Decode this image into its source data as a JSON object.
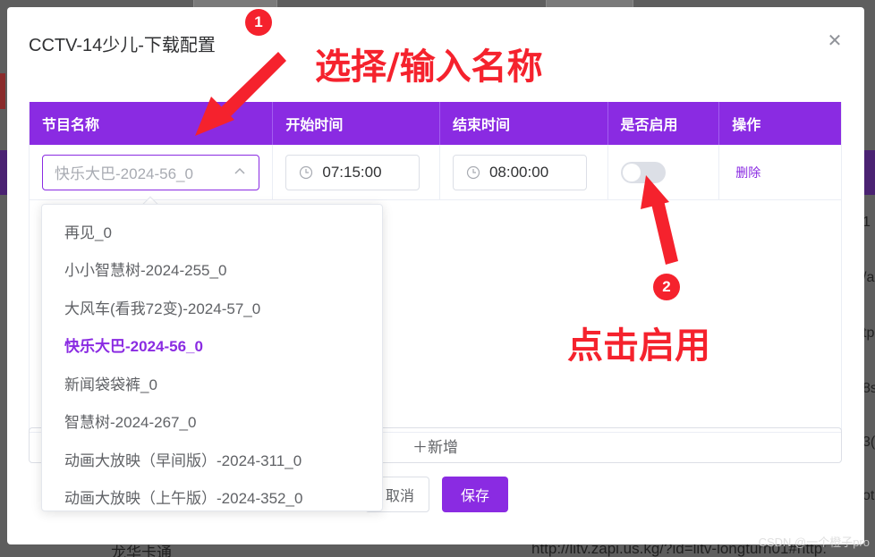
{
  "background": {
    "bottom_left_text": "龙华卡通",
    "bottom_right_text": "http://litv.zapi.us.kg/?id=litv-longturn01#http:",
    "right_col_fragments": [
      "1",
      "/a",
      "tp",
      "8s",
      "3(",
      "ot"
    ],
    "watermark": "CSDN @一个橙子pro"
  },
  "dialog": {
    "title": "CCTV-14少儿-下载配置",
    "close_icon": "close-icon"
  },
  "table": {
    "headers": [
      "节目名称",
      "开始时间",
      "结束时间",
      "是否启用",
      "操作"
    ],
    "row": {
      "program": "快乐大巴-2024-56_0",
      "start": "07:15:00",
      "end": "08:00:00",
      "enabled": false,
      "action": "删除"
    }
  },
  "dropdown": {
    "items": [
      "再见_0",
      "小小智慧树-2024-255_0",
      "大风车(看我72变)-2024-57_0",
      "快乐大巴-2024-56_0",
      "新闻袋袋裤_0",
      "智慧树-2024-267_0",
      "动画大放映（早间版）-2024-311_0",
      "动画大放映（上午版）-2024-352_0"
    ],
    "selected_index": 3
  },
  "add_button": "＋新增",
  "buttons": {
    "cancel": "取消",
    "save": "保存"
  },
  "annotations": {
    "step1_badge": "1",
    "step1_text": "选择/输入名称",
    "step2_badge": "2",
    "step2_text": "点击启用"
  },
  "colors": {
    "accent": "#8a2be2",
    "annotation": "#f5222d"
  }
}
